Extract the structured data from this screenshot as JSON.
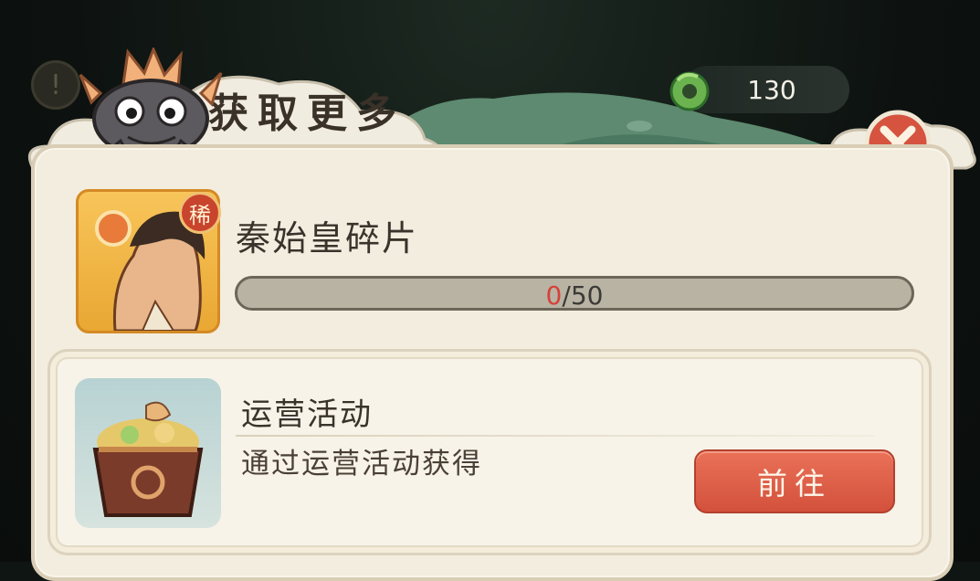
{
  "header": {
    "title": "获取更多",
    "currency": {
      "icon": "jade-dragon-icon",
      "value": "130"
    }
  },
  "item": {
    "name": "秦始皇碎片",
    "rarity_badge": "稀",
    "progress": {
      "current": "0",
      "separator": "/",
      "max": "50",
      "fraction": 0
    }
  },
  "sources": [
    {
      "title": "运营活动",
      "description": "通过运营活动获得",
      "button_label": "前往",
      "icon": "treasure-chest-icon"
    }
  ],
  "colors": {
    "panel_bg": "#f3eddf",
    "button": "#e0644b",
    "progress_current": "#d4423a",
    "portrait_bg": "#f4b543"
  }
}
